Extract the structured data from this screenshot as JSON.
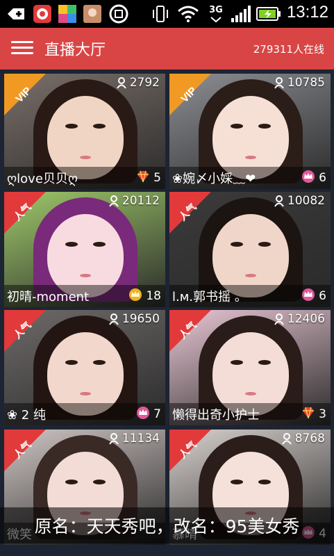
{
  "status_bar": {
    "time": "13:12",
    "network": "3G",
    "icons": [
      "plus-icon",
      "app-icon-red",
      "app-icon-colorful",
      "app-icon-avatar",
      "app-icon-circle",
      "vibrate-icon",
      "wifi-icon",
      "signal-icon",
      "battery-icon"
    ]
  },
  "header": {
    "title": "直播大厅",
    "online_count": "279311人在线",
    "bg_color": "#d94545"
  },
  "cards": [
    {
      "name": "ღlove贝贝ღ",
      "viewers": "2792",
      "gift_count": "5",
      "gift_icon": "diamond-icon",
      "tag": "VIP",
      "tag_color": "#f09a24",
      "skin": "#f1d5c4",
      "hair": "#2a1a16",
      "bg": "#7a6f6a"
    },
    {
      "name": "❀婉〆小婇﹏❤",
      "viewers": "10785",
      "gift_count": "6",
      "gift_icon": "pink-crown-icon",
      "tag": "VIP",
      "tag_color": "#f09a24",
      "skin": "#f6dfd5",
      "hair": "#2b1d18",
      "bg": "#8d8f94"
    },
    {
      "name": "初晴-moment",
      "viewers": "20112",
      "gift_count": "18",
      "gift_icon": "gold-crown-icon",
      "tag": "人气",
      "tag_color": "#e23a3a",
      "skin": "#f7dbe0",
      "hair": "#7a2a7a",
      "bg": "#9fc96a"
    },
    {
      "name": "l.м.郭书摇 。",
      "viewers": "10082",
      "gift_count": "6",
      "gift_icon": "pink-crown-icon",
      "tag": "人气",
      "tag_color": "#e23a3a",
      "skin": "#efd6c8",
      "hair": "#1b1411",
      "bg": "#3c3a3b"
    },
    {
      "name": "❀ 2 纯",
      "viewers": "19650",
      "gift_count": "7",
      "gift_icon": "pink-crown-icon",
      "tag": "人气",
      "tag_color": "#e23a3a",
      "skin": "#f2d7cc",
      "hair": "#231612",
      "bg": "#6f6a6a"
    },
    {
      "name": "懒得出奇小护士",
      "viewers": "12406",
      "gift_count": "3",
      "gift_icon": "diamond-icon",
      "tag": "人气",
      "tag_color": "#e23a3a",
      "skin": "#f4ddd6",
      "hair": "#2a1c18",
      "bg": "#e9c7d4"
    },
    {
      "name": "微笑",
      "viewers": "11134",
      "gift_count": "",
      "gift_icon": "",
      "tag": "人气",
      "tag_color": "#e23a3a",
      "skin": "#f3dcd6",
      "hair": "#3a2a26",
      "bg": "#cfc6c4"
    },
    {
      "name": "慕晴",
      "viewers": "8768",
      "gift_count": "4",
      "gift_icon": "pink-crown-icon",
      "tag": "人气",
      "tag_color": "#e23a3a",
      "skin": "#f5e1da",
      "hair": "#2a1d1a",
      "bg": "#d9d2cf"
    }
  ],
  "caption": "原名：天天秀吧，改名：95美女秀"
}
